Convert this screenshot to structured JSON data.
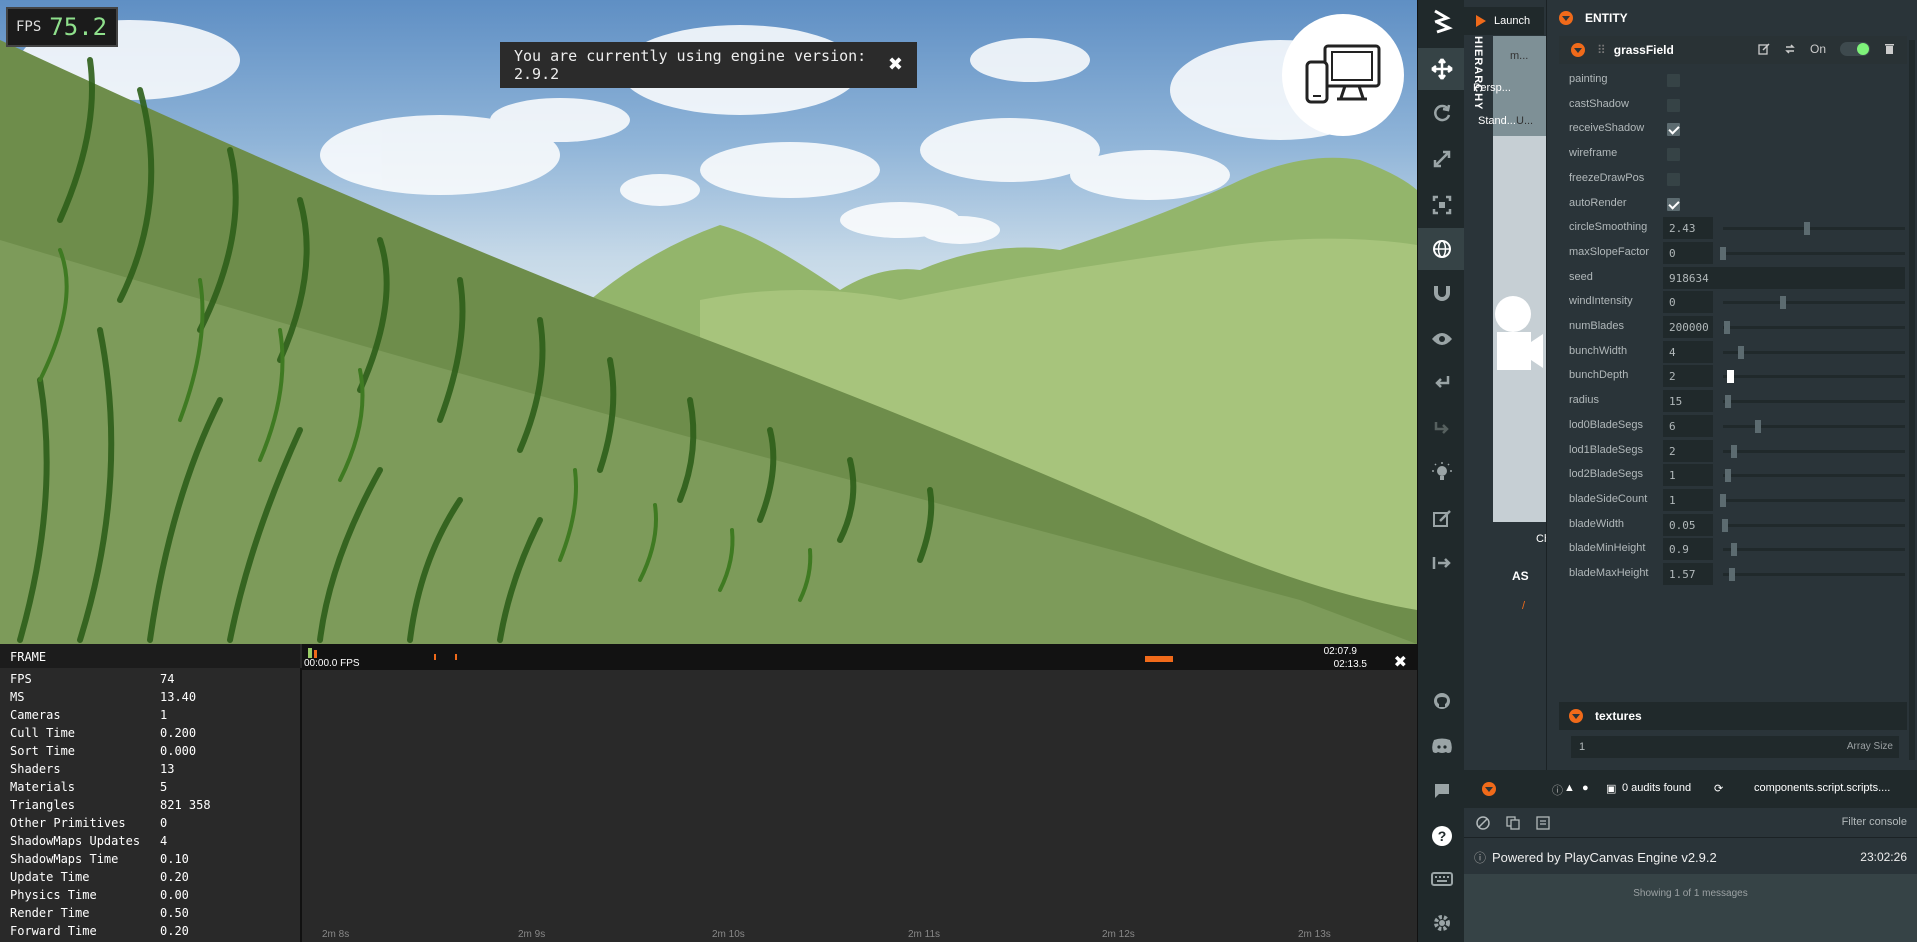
{
  "viewport": {
    "fps_label": "FPS",
    "fps_value": "75.2",
    "toast_text": "You are currently using engine version: 2.9.2",
    "toast_close": "✖"
  },
  "stats": {
    "frame_title": "FRAME",
    "rows": [
      {
        "k": "FPS",
        "v": "74"
      },
      {
        "k": "MS",
        "v": "13.40"
      },
      {
        "k": "Cameras",
        "v": "1"
      },
      {
        "k": "Cull Time",
        "v": "0.200"
      },
      {
        "k": "Sort Time",
        "v": "0.000"
      },
      {
        "k": "Shaders",
        "v": "13"
      },
      {
        "k": "Materials",
        "v": "5"
      },
      {
        "k": "Triangles",
        "v": "821 358"
      },
      {
        "k": "Other Primitives",
        "v": "0"
      },
      {
        "k": "ShadowMaps Updates",
        "v": "4"
      },
      {
        "k": "ShadowMaps Time",
        "v": "0.10"
      },
      {
        "k": "Update Time",
        "v": "0.20"
      },
      {
        "k": "Physics Time",
        "v": "0.00"
      },
      {
        "k": "Render Time",
        "v": "0.50"
      },
      {
        "k": "Forward Time",
        "v": "0.20"
      }
    ],
    "timeline_label": "00:00.0 FPS",
    "time_top": "02:07.9",
    "time_bottom": "02:13.5",
    "close": "✖",
    "ticks": [
      "2m 8s",
      "2m 9s",
      "2m 10s",
      "2m 11s",
      "2m 12s",
      "2m 13s"
    ]
  },
  "launch": "Launch",
  "hierarchy_title": "HIERARCHY",
  "mid": {
    "persp": "Persp...",
    "stand": "Stand...",
    "m": "m...",
    "u": "U...",
    "ch": "Ch",
    "as": "AS",
    "slash": "/"
  },
  "inspector": {
    "entity_title": "ENTITY",
    "script_name": "grassField",
    "on_label": "On",
    "attributes": [
      {
        "name": "painting",
        "type": "check",
        "checked": false
      },
      {
        "name": "castShadow",
        "type": "check",
        "checked": false
      },
      {
        "name": "receiveShadow",
        "type": "check",
        "checked": true
      },
      {
        "name": "wireframe",
        "type": "check",
        "checked": false
      },
      {
        "name": "freezeDrawPos",
        "type": "check",
        "checked": false
      },
      {
        "name": "autoRender",
        "type": "check",
        "checked": true
      },
      {
        "name": "circleSmoothing",
        "type": "slider",
        "value": "2.43",
        "level": 0.46
      },
      {
        "name": "maxSlopeFactor",
        "type": "slider",
        "value": "0",
        "level": 0.0
      },
      {
        "name": "seed",
        "type": "text",
        "value": "918634"
      },
      {
        "name": "windIntensity",
        "type": "slider",
        "value": "0",
        "level": 0.33
      },
      {
        "name": "numBlades",
        "type": "slider",
        "value": "200000",
        "level": 0.02
      },
      {
        "name": "bunchWidth",
        "type": "slider",
        "value": "4",
        "level": 0.1
      },
      {
        "name": "bunchDepth",
        "type": "slider",
        "value": "2",
        "level": 0.04
      },
      {
        "name": "radius",
        "type": "slider",
        "value": "15",
        "level": 0.03
      },
      {
        "name": "lod0BladeSegs",
        "type": "slider",
        "value": "6",
        "level": 0.19
      },
      {
        "name": "lod1BladeSegs",
        "type": "slider",
        "value": "2",
        "level": 0.06
      },
      {
        "name": "lod2BladeSegs",
        "type": "slider",
        "value": "1",
        "level": 0.03
      },
      {
        "name": "bladeSideCount",
        "type": "slider",
        "value": "1",
        "level": 0.0
      },
      {
        "name": "bladeWidth",
        "type": "slider",
        "value": "0.05",
        "level": 0.01
      },
      {
        "name": "bladeMinHeight",
        "type": "slider",
        "value": "0.9",
        "level": 0.06
      },
      {
        "name": "bladeMaxHeight",
        "type": "slider",
        "value": "1.57",
        "level": 0.05
      }
    ],
    "textures_title": "textures",
    "array_size_value": "1",
    "array_size_label": "Array Size"
  },
  "console": {
    "audits": "0 audits found",
    "path": "components.script.scripts....",
    "filter": "Filter console",
    "message": "Powered by PlayCanvas Engine v2.9.2",
    "time": "23:02:26",
    "showing": "Showing 1 of 1 messages"
  },
  "colors": {
    "accent": "#f06a1a",
    "panel": "#2a3439",
    "dark": "#20292b",
    "toggle_on": "#7ef27a"
  }
}
